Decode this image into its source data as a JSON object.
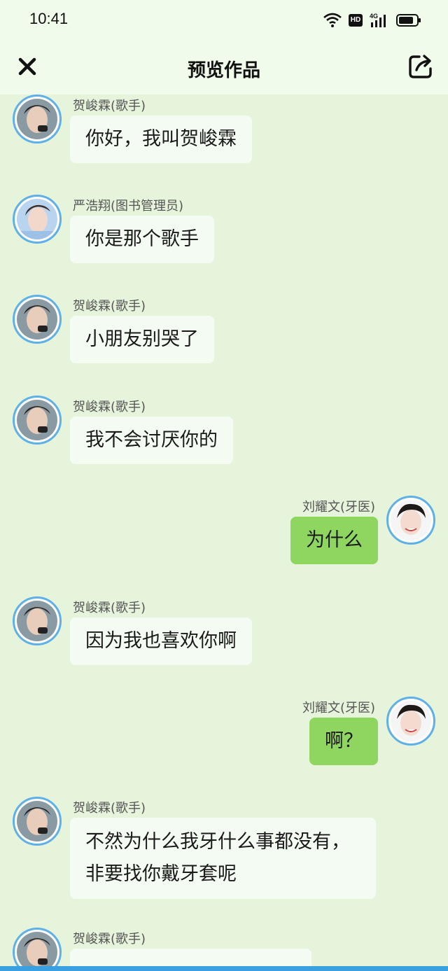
{
  "status_bar": {
    "time": "10:41",
    "hd": "HD",
    "network": "4G"
  },
  "header": {
    "title": "预览作品"
  },
  "messages": [
    {
      "side": "left",
      "sender": "贺峻霖(歌手)",
      "text": "你好，我叫贺峻霖"
    },
    {
      "side": "left",
      "sender": "严浩翔(图书管理员)",
      "text": "你是那个歌手"
    },
    {
      "side": "left",
      "sender": "贺峻霖(歌手)",
      "text": "小朋友别哭了"
    },
    {
      "side": "left",
      "sender": "贺峻霖(歌手)",
      "text": "我不会讨厌你的"
    },
    {
      "side": "right",
      "sender": "刘耀文(牙医)",
      "text": "为什么"
    },
    {
      "side": "left",
      "sender": "贺峻霖(歌手)",
      "text": "因为我也喜欢你啊"
    },
    {
      "side": "right",
      "sender": "刘耀文(牙医)",
      "text": "啊？"
    },
    {
      "side": "left",
      "sender": "贺峻霖(歌手)",
      "text": "不然为什么我牙什么事都没有，非要找你戴牙套呢"
    },
    {
      "side": "left",
      "sender": "贺峻霖(歌手)",
      "text": ""
    }
  ],
  "colors": {
    "background": "#e6f4dc",
    "header": "#f1fbeb",
    "bubble_left": "#f4fbf2",
    "bubble_right": "#8fd661",
    "avatar_ring": "#5fb0e6"
  },
  "icons": {
    "close": "close-icon",
    "share": "share-icon"
  }
}
